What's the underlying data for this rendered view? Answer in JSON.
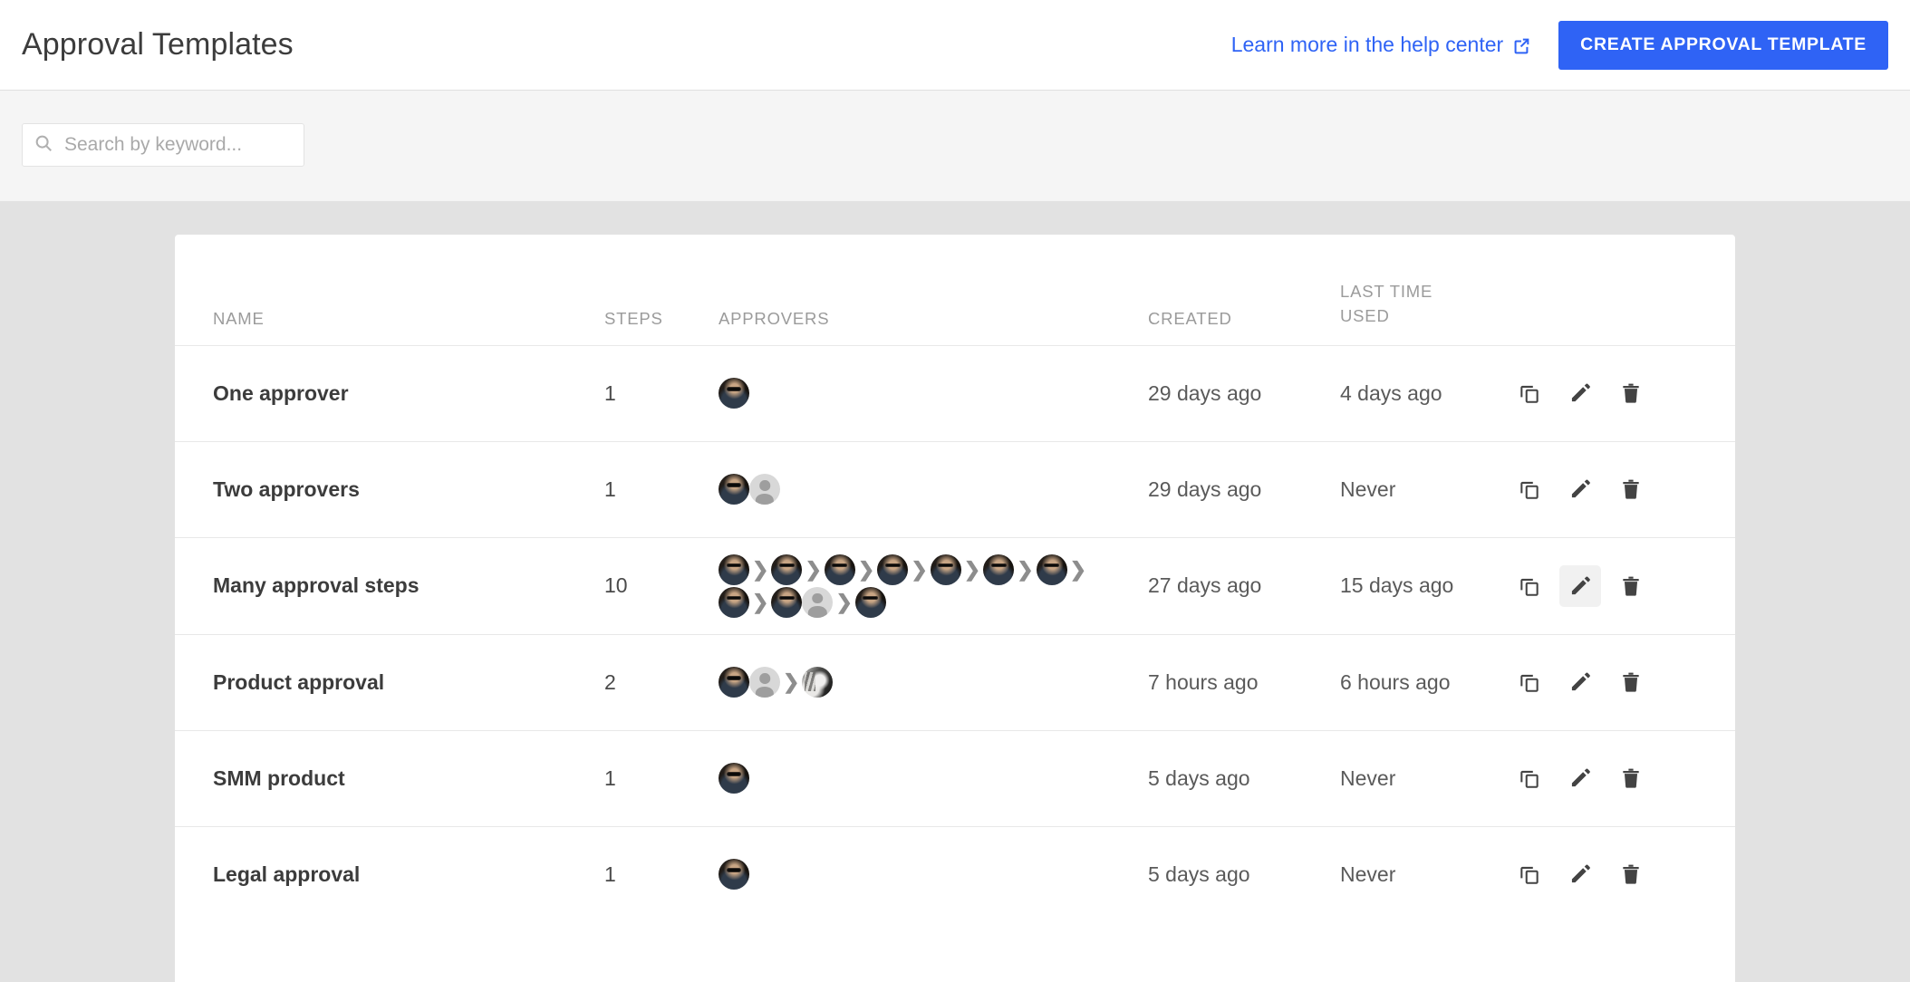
{
  "header": {
    "title": "Approval Templates",
    "help_link_label": "Learn more in the help center",
    "help_link_icon": "external-link-icon",
    "create_button_label": "CREATE APPROVAL TEMPLATE"
  },
  "search": {
    "icon": "search-icon",
    "placeholder": "Search by keyword...",
    "value": ""
  },
  "colors": {
    "accent": "#2f63f5",
    "page_background": "#e2e2e2",
    "search_band": "#f5f5f5",
    "card": "#ffffff",
    "header_text": "#9b9b9b",
    "row_title": "#3c3c3c",
    "row_text": "#5a5a5a",
    "hover_background": "#f1f1f1"
  },
  "table": {
    "columns": [
      {
        "key": "name",
        "label": "NAME"
      },
      {
        "key": "steps",
        "label": "STEPS"
      },
      {
        "key": "approvers",
        "label": "APPROVERS"
      },
      {
        "key": "created",
        "label": "CREATED"
      },
      {
        "key": "last_time_used",
        "label_line1": "LAST TIME",
        "label_line2": "USED"
      },
      {
        "key": "actions",
        "label": ""
      }
    ],
    "row_actions": [
      {
        "name": "duplicate-template-button",
        "icon": "copy-icon",
        "label": "Duplicate"
      },
      {
        "name": "edit-template-button",
        "icon": "pencil-icon",
        "label": "Edit"
      },
      {
        "name": "delete-template-button",
        "icon": "trash-icon",
        "label": "Delete"
      }
    ],
    "rows": [
      {
        "name": "One approver",
        "steps": "1",
        "created": "29 days ago",
        "last_time_used": "4 days ago",
        "approvers": [
          "photo-a"
        ],
        "edit_hovered": false
      },
      {
        "name": "Two approvers",
        "steps": "1",
        "created": "29 days ago",
        "last_time_used": "Never",
        "approvers": [
          "photo-a",
          "placeholder"
        ],
        "edit_hovered": false
      },
      {
        "name": "Many approval steps",
        "steps": "10",
        "created": "27 days ago",
        "last_time_used": "15 days ago",
        "approvers": [
          "photo-a",
          "chevron",
          "photo-a",
          "chevron",
          "photo-a",
          "chevron",
          "photo-a",
          "chevron",
          "photo-a",
          "chevron",
          "photo-a",
          "chevron",
          "photo-a",
          "chevron",
          "photo-a",
          "chevron",
          "photo-a",
          "placeholder",
          "chevron",
          "photo-a"
        ],
        "edit_hovered": true
      },
      {
        "name": "Product approval",
        "steps": "2",
        "created": "7 hours ago",
        "last_time_used": "6 hours ago",
        "approvers": [
          "photo-a",
          "placeholder",
          "chevron",
          "photo-b"
        ],
        "edit_hovered": false
      },
      {
        "name": "SMM product",
        "steps": "1",
        "created": "5 days ago",
        "last_time_used": "Never",
        "approvers": [
          "photo-a"
        ],
        "edit_hovered": false
      },
      {
        "name": "Legal approval",
        "steps": "1",
        "created": "5 days ago",
        "last_time_used": "Never",
        "approvers": [
          "photo-a"
        ],
        "edit_hovered": false
      }
    ]
  }
}
